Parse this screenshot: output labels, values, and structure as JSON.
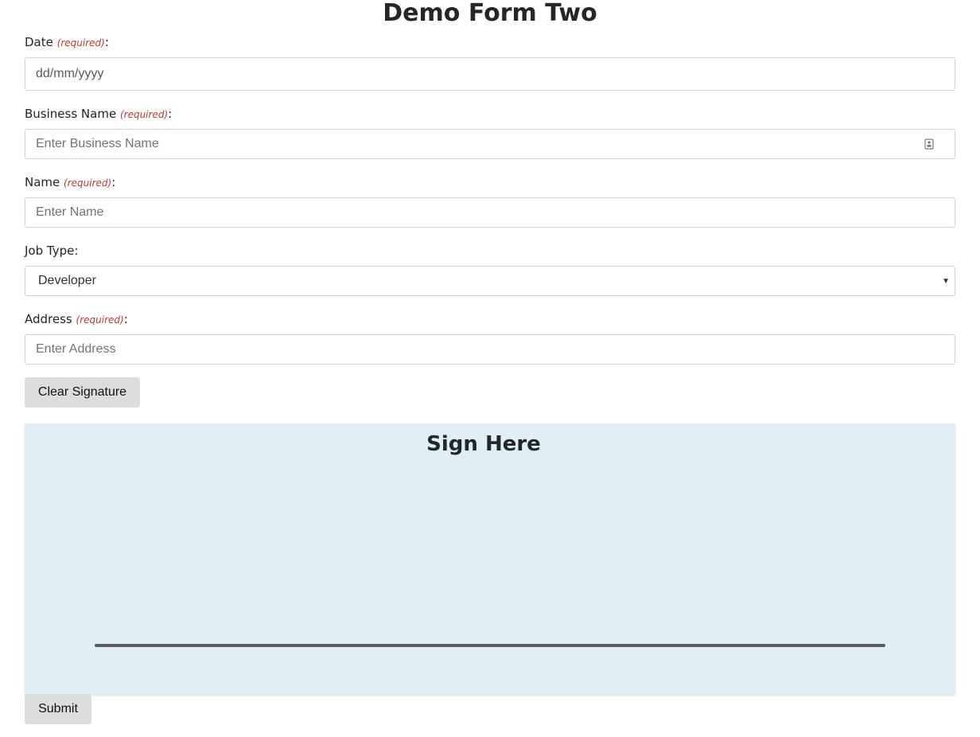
{
  "form": {
    "title": "Demo Form Two",
    "required_marker": "(required)",
    "colon": ":",
    "fields": {
      "date": {
        "label": "Date",
        "value": "dd/mm/yyyy"
      },
      "business_name": {
        "label": "Business Name",
        "placeholder": "Enter Business Name",
        "icon": "contact-card-icon"
      },
      "name": {
        "label": "Name",
        "placeholder": "Enter Name"
      },
      "job_type": {
        "label": "Job Type:",
        "selected": "Developer"
      },
      "address": {
        "label": "Address",
        "placeholder": "Enter Address"
      }
    },
    "clear_signature_label": "Clear Signature",
    "signature": {
      "title": "Sign Here",
      "background": "#e0eef5",
      "line_color": "#5a5a5a"
    },
    "submit_label": "Submit"
  },
  "colors": {
    "required": "#c0392b",
    "button_bg": "#dddddd",
    "input_border": "#ced4da"
  }
}
